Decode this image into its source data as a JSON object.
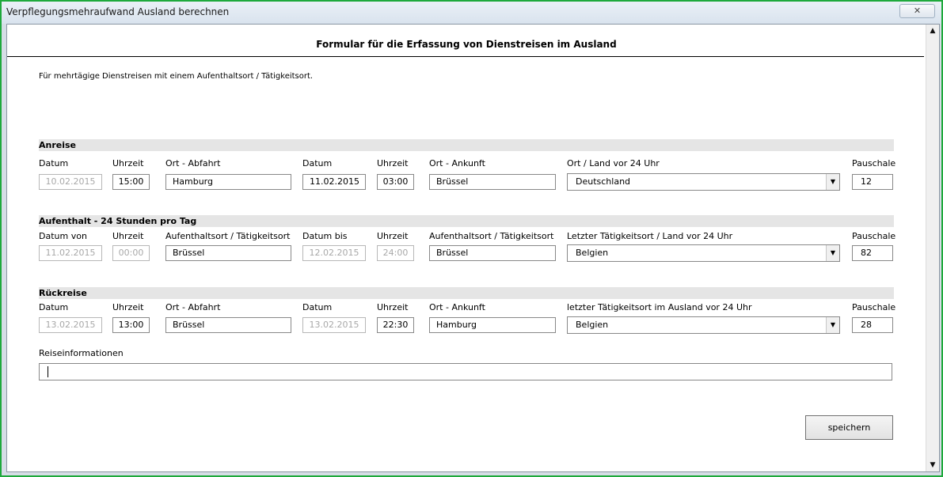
{
  "window": {
    "title": "Verpflegungsmehraufwand Ausland berechnen",
    "close_glyph": "✕"
  },
  "form": {
    "title": "Formular für die Erfassung von Dienstreisen im Ausland",
    "intro": "Für mehrtägige Dienstreisen mit einem Aufenthaltsort / Tätigkeitsort."
  },
  "anreise": {
    "heading": "Anreise",
    "labels": {
      "datum1": "Datum",
      "uhrzeit1": "Uhrzeit",
      "ort1": "Ort - Abfahrt",
      "datum2": "Datum",
      "uhrzeit2": "Uhrzeit",
      "ort2": "Ort - Ankunft",
      "land": "Ort / Land vor 24 Uhr",
      "pauschale": "Pauschale"
    },
    "values": {
      "datum1": "10.02.2015",
      "uhrzeit1": "15:00",
      "ort1": "Hamburg",
      "datum2": "11.02.2015",
      "uhrzeit2": "03:00",
      "ort2": "Brüssel",
      "land": "Deutschland",
      "pauschale": "12"
    }
  },
  "aufenthalt": {
    "heading": "Aufenthalt - 24 Stunden pro Tag",
    "labels": {
      "datum1": "Datum von",
      "uhrzeit1": "Uhrzeit",
      "ort1": "Aufenthaltsort / Tätigkeitsort",
      "datum2": "Datum bis",
      "uhrzeit2": "Uhrzeit",
      "ort2": "Aufenthaltsort / Tätigkeitsort",
      "land": "Letzter Tätigkeitsort / Land vor 24 Uhr",
      "pauschale": "Pauschale"
    },
    "values": {
      "datum1": "11.02.2015",
      "uhrzeit1": "00:00",
      "ort1": "Brüssel",
      "datum2": "12.02.2015",
      "uhrzeit2": "24:00",
      "ort2": "Brüssel",
      "land": "Belgien",
      "pauschale": "82"
    }
  },
  "rueckreise": {
    "heading": "Rückreise",
    "labels": {
      "datum1": "Datum",
      "uhrzeit1": "Uhrzeit",
      "ort1": "Ort - Abfahrt",
      "datum2": "Datum",
      "uhrzeit2": "Uhrzeit",
      "ort2": "Ort - Ankunft",
      "land": "letzter Tätigkeitsort im Ausland vor 24 Uhr",
      "pauschale": "Pauschale"
    },
    "values": {
      "datum1": "13.02.2015",
      "uhrzeit1": "13:00",
      "ort1": "Brüssel",
      "datum2": "13.02.2015",
      "uhrzeit2": "22:30",
      "ort2": "Hamburg",
      "land": "Belgien",
      "pauschale": "28"
    }
  },
  "reiseinformationen": {
    "label": "Reiseinformationen",
    "value": ""
  },
  "buttons": {
    "save": "speichern"
  },
  "icons": {
    "dropdown": "▼",
    "scroll_up": "▲",
    "scroll_down": "▼"
  }
}
